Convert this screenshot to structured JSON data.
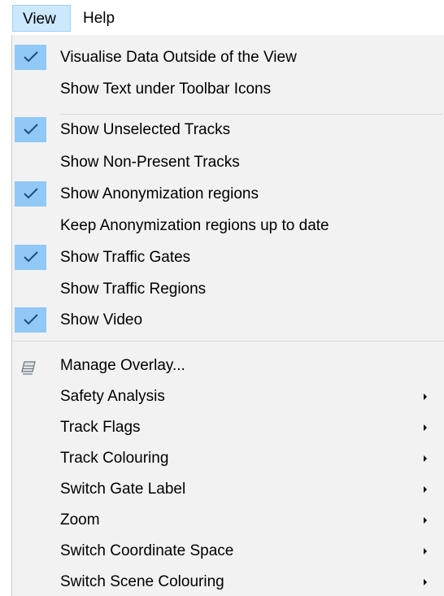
{
  "menubar": {
    "view": "View",
    "help": "Help"
  },
  "menu": {
    "group1": [
      {
        "label": "Visualise Data Outside of the View",
        "checked": true
      },
      {
        "label": "Show Text under Toolbar Icons",
        "checked": false
      }
    ],
    "group2": [
      {
        "label": "Show Unselected Tracks",
        "checked": true
      },
      {
        "label": "Show Non-Present Tracks",
        "checked": false
      },
      {
        "label": "Show Anonymization regions",
        "checked": true
      },
      {
        "label": "Keep Anonymization regions up to date",
        "checked": false
      },
      {
        "label": "Show Traffic Gates",
        "checked": true
      },
      {
        "label": "Show Traffic Regions",
        "checked": false
      },
      {
        "label": "Show Video",
        "checked": true
      }
    ],
    "group3": [
      {
        "label": "Manage Overlay...",
        "icon": "layers-icon",
        "submenu": false
      },
      {
        "label": "Safety Analysis",
        "submenu": true
      },
      {
        "label": "Track Flags",
        "submenu": true
      },
      {
        "label": "Track Colouring",
        "submenu": true
      },
      {
        "label": "Switch Gate Label",
        "submenu": true
      },
      {
        "label": "Zoom",
        "submenu": true
      },
      {
        "label": "Switch Coordinate Space",
        "submenu": true
      },
      {
        "label": "Switch Scene Colouring",
        "submenu": true
      }
    ]
  },
  "colors": {
    "check_bg": "#90c8f6",
    "menu_bg": "#f2f2f2",
    "active_menubar": "#cce8ff"
  }
}
